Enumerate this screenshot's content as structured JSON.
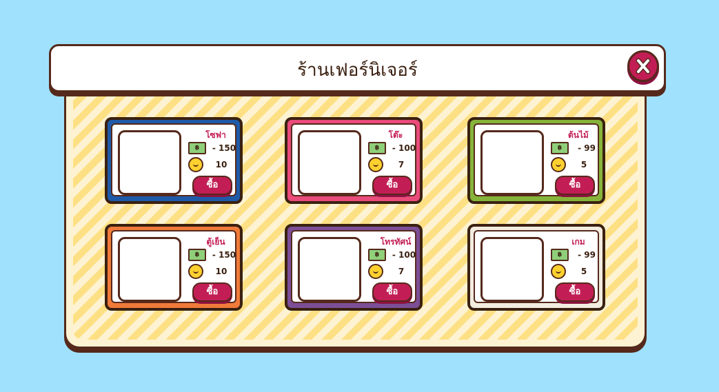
{
  "shop": {
    "title": "ร้านเฟอร์นิเจอร์",
    "close_label": "X",
    "buy_label": "ซื้อ",
    "bill_symbol": "฿",
    "items": [
      {
        "name": "โซฟา",
        "cash": "- 150",
        "coins": "10",
        "border_color": "#1f5aa8"
      },
      {
        "name": "โต๊ะ",
        "cash": "- 100",
        "coins": "7",
        "border_color": "#e94b7a"
      },
      {
        "name": "ต้นไม้",
        "cash": "- 99",
        "coins": "5",
        "border_color": "#86b43a"
      },
      {
        "name": "ตู้เย็น",
        "cash": "- 150",
        "coins": "10",
        "border_color": "#f07a3a"
      },
      {
        "name": "โทรทัศน์",
        "cash": "- 100",
        "coins": "7",
        "border_color": "#7c4e96"
      },
      {
        "name": "เกม",
        "cash": "- 99",
        "coins": "5",
        "border_color": "#f3ece0"
      }
    ]
  }
}
